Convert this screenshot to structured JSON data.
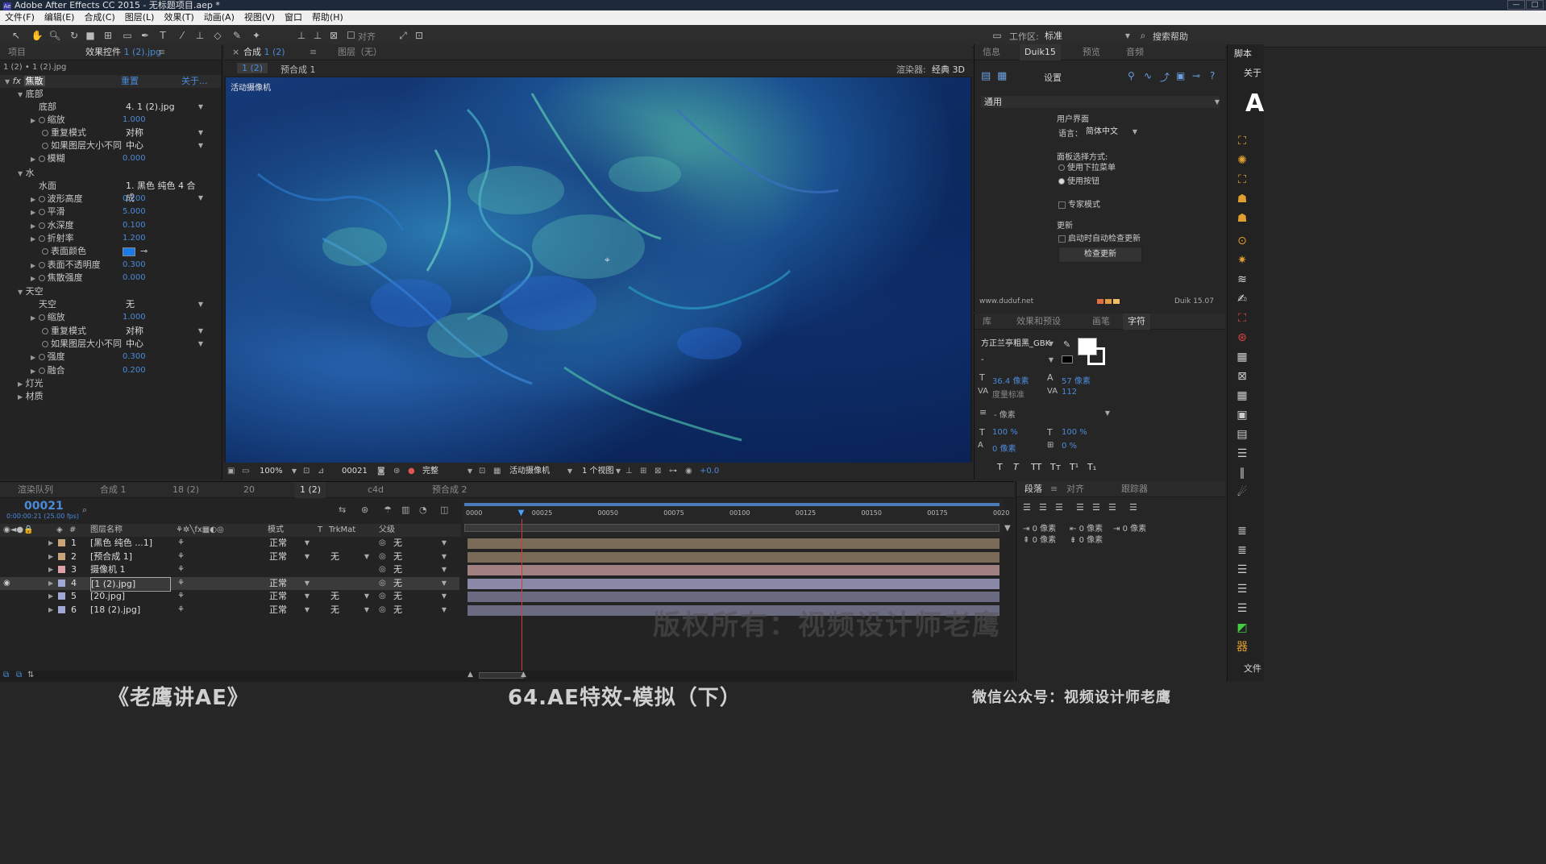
{
  "app": {
    "title": "Adobe After Effects CC 2015 - 无标题项目.aep *"
  },
  "menu": [
    "文件(F)",
    "编辑(E)",
    "合成(C)",
    "图层(L)",
    "效果(T)",
    "动画(A)",
    "视图(V)",
    "窗口",
    "帮助(H)"
  ],
  "toolbar": {
    "snap_label": "对齐",
    "workspace_label": "工作区:",
    "workspace_value": "标准",
    "search_help": "搜索帮助"
  },
  "left_panel": {
    "tab_project": "项目",
    "tab_effects": "效果控件",
    "tab_effects_file": "1 (2).jpg",
    "subheader": "1 (2) • 1 (2).jpg",
    "effect_name": "焦散",
    "reset": "重置",
    "about": "关于...",
    "groups": {
      "bottom": "底部",
      "water": "水",
      "sky": "天空",
      "lights": "灯光",
      "material": "材质"
    },
    "params": [
      {
        "label": "底部",
        "value": "4. 1 (2).jpg",
        "type": "dropdown"
      },
      {
        "label": "缩放",
        "value": "1.000",
        "type": "num"
      },
      {
        "label": "重复模式",
        "value": "对称",
        "type": "dropdown"
      },
      {
        "label": "如果图层大小不同",
        "value": "中心",
        "type": "dropdown"
      },
      {
        "label": "模糊",
        "value": "0.000",
        "type": "num"
      },
      {
        "label": "水面",
        "value": "1. 黑色 纯色 4 合成",
        "type": "dropdown"
      },
      {
        "label": "波形高度",
        "value": "0.200",
        "type": "num"
      },
      {
        "label": "平滑",
        "value": "5.000",
        "type": "num"
      },
      {
        "label": "水深度",
        "value": "0.100",
        "type": "num"
      },
      {
        "label": "折射率",
        "value": "1.200",
        "type": "num"
      },
      {
        "label": "表面颜色",
        "value": "",
        "type": "color"
      },
      {
        "label": "表面不透明度",
        "value": "0.300",
        "type": "num"
      },
      {
        "label": "焦散强度",
        "value": "0.000",
        "type": "num"
      },
      {
        "label": "天空",
        "value": "无",
        "type": "dropdown"
      },
      {
        "label": "缩放",
        "value": "1.000",
        "type": "num"
      },
      {
        "label": "重复模式",
        "value": "对称",
        "type": "dropdown"
      },
      {
        "label": "如果图层大小不同",
        "value": "中心",
        "type": "dropdown"
      },
      {
        "label": "强度",
        "value": "0.300",
        "type": "num"
      },
      {
        "label": "融合",
        "value": "0.200",
        "type": "num"
      }
    ]
  },
  "comp_panel": {
    "tab_comp": "合成",
    "tab_comp_name": "1 (2)",
    "tab_layer": "图层（无）",
    "breadcrumb_1": "1 (2)",
    "breadcrumb_2": "预合成 1",
    "renderer_label": "渲染器:",
    "renderer_value": "经典 3D",
    "camera_label": "活动摄像机",
    "zoom": "100%",
    "timecode": "00021",
    "resolution": "完整",
    "camera_select": "活动摄像机",
    "views": "1 个视图",
    "exposure": "+0.0"
  },
  "right_panel": {
    "tabs": [
      "信息",
      "Duik15",
      "预览",
      "音频"
    ],
    "settings": "设置",
    "general": "通用",
    "ui_label": "用户界面",
    "language_label": "语言：",
    "language_value": "简体中文",
    "panel_select_label": "面板选择方式:",
    "option_dropdown": "使用下拉菜单",
    "option_buttons": "使用按钮",
    "expert_mode": "专家模式",
    "update_label": "更新",
    "auto_update": "启动时自动检查更新",
    "check_update": "检查更新",
    "site": "www.duduf.net",
    "version": "Duik 15.07"
  },
  "char_panel": {
    "tabs": [
      "库",
      "效果和预设",
      "画笔",
      "字符"
    ],
    "font": "方正兰亭粗黑_GBK",
    "style": "-",
    "size": "36.4 像素",
    "leading": "57 像素",
    "kerning": "度量标准",
    "tracking": "112",
    "stroke": "- 像素",
    "vscale": "100 %",
    "hscale": "100 %",
    "baseline": "0 像素",
    "tsume": "0 %"
  },
  "para_panel": {
    "tabs": [
      "段落",
      "对齐",
      "跟踪器"
    ],
    "indent_left": "0 像素",
    "indent_right": "0 像素",
    "indent_first": "0 像素",
    "space_before": "0 像素",
    "space_after": "0 像素"
  },
  "scripts_panel": {
    "title": "脚本",
    "about": "关于",
    "file": "文件"
  },
  "timeline": {
    "tabs": [
      "渲染队列",
      "合成 1",
      "18 (2)",
      "20",
      "1 (2)",
      "c4d",
      "预合成 2"
    ],
    "timecode": "00021",
    "timecode_sub": "0:00:00:21 (25.00 fps)",
    "col_name": "图层名称",
    "col_mode": "模式",
    "col_t": "T",
    "col_trkmat": "TrkMat",
    "col_parent": "父级",
    "ruler": [
      "0000",
      "00025",
      "00050",
      "00075",
      "00100",
      "00125",
      "00150",
      "00175",
      "0020"
    ],
    "playhead_frame": 21,
    "layers": [
      {
        "num": "1",
        "name": "[黑色 纯色 ...1]",
        "mode": "正常",
        "trk": "",
        "parent": "无",
        "color": "#c8a478",
        "bar": "#7a6a58"
      },
      {
        "num": "2",
        "name": "[预合成 1]",
        "mode": "正常",
        "trk": "无",
        "parent": "无",
        "color": "#c8a478",
        "bar": "#7a6a58"
      },
      {
        "num": "3",
        "name": "摄像机 1",
        "mode": "",
        "trk": "",
        "parent": "无",
        "color": "#e0a0a8",
        "bar": "#a08080"
      },
      {
        "num": "4",
        "name": "[1 (2).jpg]",
        "mode": "正常",
        "trk": "",
        "parent": "无",
        "color": "#a0a8d8",
        "bar": "#8a8aa8"
      },
      {
        "num": "5",
        "name": "[20.jpg]",
        "mode": "正常",
        "trk": "无",
        "parent": "无",
        "color": "#a0a8d8",
        "bar": "#6a6a80"
      },
      {
        "num": "6",
        "name": "[18 (2).jpg]",
        "mode": "正常",
        "trk": "无",
        "parent": "无",
        "color": "#a0a8d8",
        "bar": "#6a6a80"
      }
    ]
  },
  "watermark": "版权所有：视频设计师老鹰",
  "captions": {
    "left": "《老鹰讲AE》",
    "center": "64.AE特效-模拟（下）",
    "right": "微信公众号：视频设计师老鹰"
  }
}
